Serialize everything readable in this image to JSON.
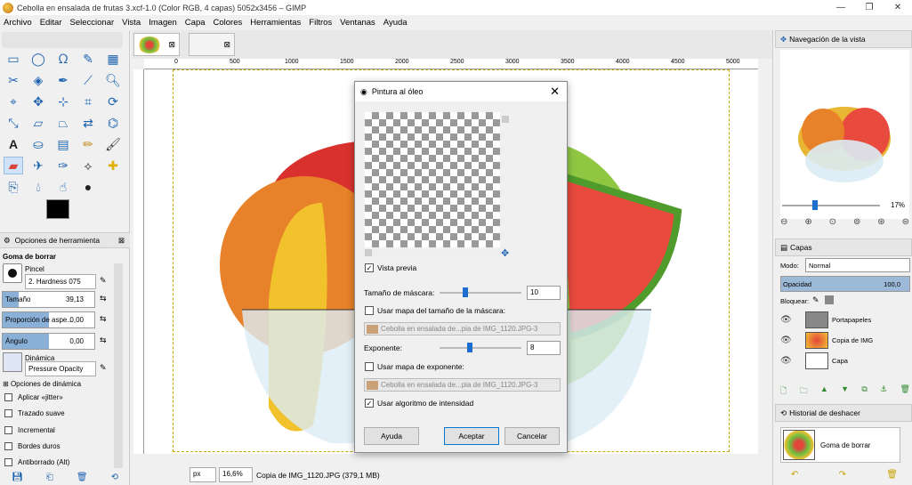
{
  "window": {
    "title": "Cebolla en ensalada de frutas 3.xcf-1.0 (Color RGB, 4 capas) 5052x3456 – GIMP",
    "controls": [
      "—",
      "❐",
      "✕"
    ]
  },
  "menu": [
    "Archivo",
    "Editar",
    "Seleccionar",
    "Vista",
    "Imagen",
    "Capa",
    "Colores",
    "Herramientas",
    "Filtros",
    "Ventanas",
    "Ayuda"
  ],
  "tool_options": {
    "tab_label": "Opciones de herramienta",
    "tool_name": "Goma de borrar",
    "brush_label": "Pincel",
    "brush_value": "2. Hardness 075",
    "size_label": "Tamaño",
    "size_value": "39,13",
    "aspect_label": "Proporción de aspe...",
    "aspect_value": "0,00",
    "angle_label": "Ángulo",
    "angle_value": "0,00",
    "dynamics_label": "Dinámica",
    "dynamics_value": "Pressure Opacity",
    "dynamics_options": "Opciones de dinámica",
    "checkboxes": [
      "Aplicar «jitter»",
      "Trazado suave",
      "Incremental",
      "Bordes duros",
      "Antiborrado  (Alt)"
    ]
  },
  "ruler": [
    "0",
    "500",
    "1000",
    "1500",
    "2000",
    "2500",
    "3000",
    "3500",
    "4000",
    "4500",
    "5000"
  ],
  "status": {
    "unit": "px",
    "zoom": "16,6%",
    "message": "Copia de IMG_1120.JPG (379,1 MB)"
  },
  "dialog": {
    "title": "Pintura al óleo",
    "preview_label": "Vista previa",
    "mask_size_label": "Tamaño de máscara:",
    "mask_size_value": "10",
    "mask_size_fraction": 0.3,
    "use_mask_map": "Usar mapa del tamaño de la máscara:",
    "combo1": "Cebolla en ensalada de...pia de IMG_1120.JPG-3",
    "exponent_label": "Exponente:",
    "exponent_value": "8",
    "exponent_fraction": 0.36,
    "use_exp_map": "Usar mapa de exponente:",
    "combo2": "Cebolla en ensalada de...pia de IMG_1120.JPG-3",
    "intensity_label": "Usar algoritmo de intensidad",
    "help": "Ayuda",
    "ok": "Aceptar",
    "cancel": "Cancelar"
  },
  "navigation": {
    "tab": "Navegación de la vista",
    "zoom_value": "17%"
  },
  "layers": {
    "tab": "Capas",
    "mode_label": "Modo:",
    "mode_value": "Normal",
    "opacity_label": "Opacidad",
    "opacity_value": "100,0",
    "lock_label": "Bloquear:",
    "items": [
      {
        "name": "Portapapeles"
      },
      {
        "name": "Copia de IMG"
      },
      {
        "name": "Capa"
      }
    ]
  },
  "history": {
    "tab": "Historial de deshacer",
    "item": "Goma de borrar"
  }
}
